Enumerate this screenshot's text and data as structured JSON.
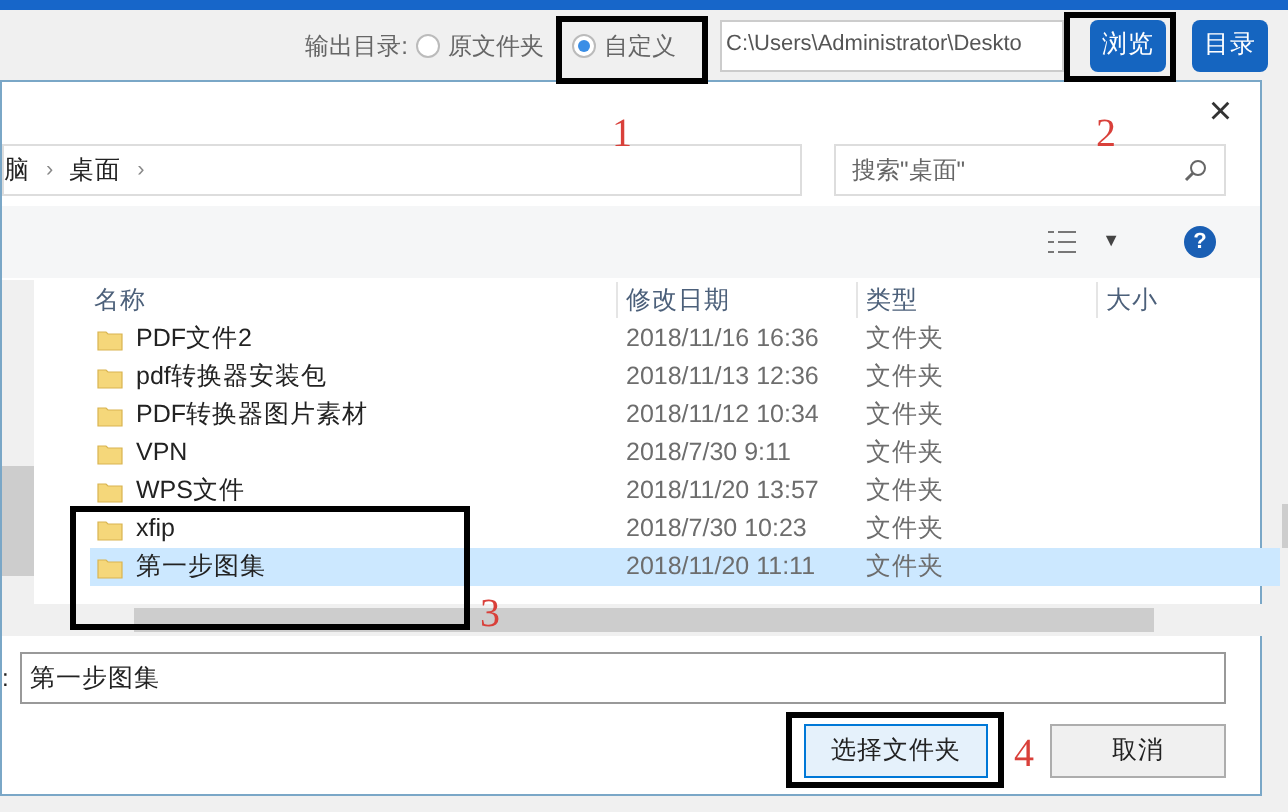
{
  "toolbar": {
    "label": "输出目录:",
    "options": [
      {
        "label": "原文件夹",
        "selected": false
      },
      {
        "label": "自定义",
        "selected": true
      }
    ],
    "path": "C:\\Users\\Administrator\\Deskto",
    "buttons": [
      "浏览",
      "目录"
    ]
  },
  "dialog": {
    "close": "×",
    "breadcrumb": [
      {
        "label": "脑",
        "separator": "›"
      },
      {
        "label": "桌面",
        "separator": "›"
      }
    ],
    "search": {
      "placeholder": "搜索\"桌面\""
    },
    "view_caret": "▼",
    "help": "?",
    "columns": [
      "名称",
      "修改日期",
      "类型",
      "大小"
    ],
    "rows": [
      {
        "name": "PDF文件2",
        "date": "2018/11/16 16:36",
        "type": "文件夹",
        "selected": false
      },
      {
        "name": "pdf转换器安装包",
        "date": "2018/11/13 12:36",
        "type": "文件夹",
        "selected": false
      },
      {
        "name": "PDF转换器图片素材",
        "date": "2018/11/12 10:34",
        "type": "文件夹",
        "selected": false
      },
      {
        "name": "VPN",
        "date": "2018/7/30 9:11",
        "type": "文件夹",
        "selected": false
      },
      {
        "name": "WPS文件",
        "date": "2018/11/20 13:57",
        "type": "文件夹",
        "selected": false
      },
      {
        "name": "xfip",
        "date": "2018/7/30 10:23",
        "type": "文件夹",
        "selected": false
      },
      {
        "name": "第一步图集",
        "date": "2018/11/20 11:11",
        "type": "文件夹",
        "selected": true
      }
    ],
    "filename_label": ":",
    "filename": "第一步图集",
    "buttons": [
      {
        "label": "选择文件夹",
        "kind": "primary"
      },
      {
        "label": "取消",
        "kind": "normal"
      }
    ]
  },
  "annotations": [
    {
      "label": "1"
    },
    {
      "label": "2"
    },
    {
      "label": "3"
    },
    {
      "label": "4"
    }
  ]
}
